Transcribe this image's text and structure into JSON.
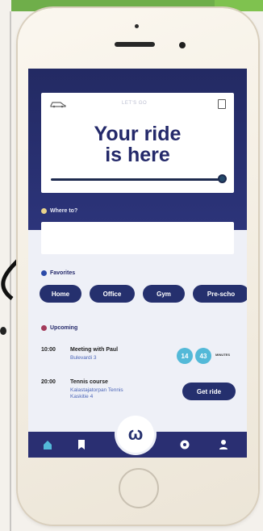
{
  "card": {
    "title_line1": "Your ride",
    "title_line2": "is here",
    "small_text": "LET'S GO"
  },
  "sections": {
    "where_to": "Where to?",
    "favorites": "Favorites",
    "upcoming": "Upcoming"
  },
  "favorites": [
    "Home",
    "Office",
    "Gym",
    "Pre-scho"
  ],
  "upcoming": [
    {
      "time": "10:00",
      "title": "Meeting with Paul",
      "subtitle": "Bulevardi 3",
      "badges": [
        "14",
        "43"
      ],
      "note": "MINUTES"
    },
    {
      "time": "20:00",
      "title": "Tennis course",
      "subtitle_line1": "Kalastajatorpan Tennis",
      "subtitle_line2": "Kaskitie 4",
      "button": "Get ride"
    }
  ],
  "center_logo": "ω",
  "colors": {
    "navy": "#25306e",
    "accent_blue": "#53b9d8",
    "hero": "#232a63"
  },
  "icons": [
    "home-icon",
    "bookmark-icon",
    "w-logo-icon",
    "soccer-ball-icon",
    "profile-icon"
  ]
}
